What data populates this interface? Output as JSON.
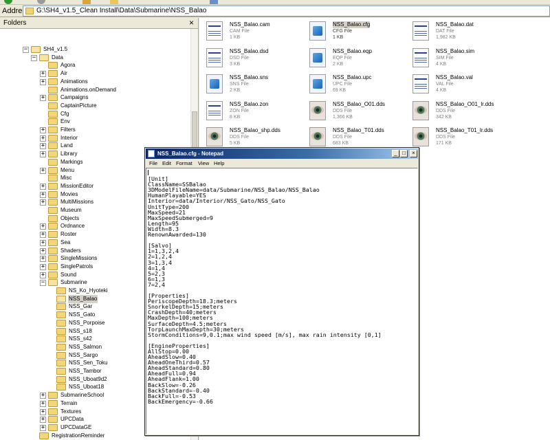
{
  "address": {
    "label": "Address",
    "path": "G:\\SH4_v1.5_Clean Install\\Data\\Submarine\\NSS_Balao"
  },
  "folders_pane": {
    "title": "Folders",
    "close_glyph": "×",
    "tree": [
      {
        "label": "SH4_v1.5",
        "level": 0,
        "expander": "−",
        "open": true
      },
      {
        "label": "Data",
        "level": 1,
        "expander": "−",
        "open": true
      },
      {
        "label": "Agora",
        "level": 2,
        "expander": ""
      },
      {
        "label": "Air",
        "level": 2,
        "expander": "+"
      },
      {
        "label": "Animations",
        "level": 2,
        "expander": "+"
      },
      {
        "label": "Animations.onDemand",
        "level": 2,
        "expander": ""
      },
      {
        "label": "Campaigns",
        "level": 2,
        "expander": "+"
      },
      {
        "label": "CaptainPicture",
        "level": 2,
        "expander": ""
      },
      {
        "label": "Cfg",
        "level": 2,
        "expander": ""
      },
      {
        "label": "Env",
        "level": 2,
        "expander": ""
      },
      {
        "label": "Filters",
        "level": 2,
        "expander": "+"
      },
      {
        "label": "Interior",
        "level": 2,
        "expander": "+"
      },
      {
        "label": "Land",
        "level": 2,
        "expander": "+"
      },
      {
        "label": "Library",
        "level": 2,
        "expander": "+"
      },
      {
        "label": "Markings",
        "level": 2,
        "expander": ""
      },
      {
        "label": "Menu",
        "level": 2,
        "expander": "+"
      },
      {
        "label": "Misc",
        "level": 2,
        "expander": ""
      },
      {
        "label": "MissionEditor",
        "level": 2,
        "expander": "+"
      },
      {
        "label": "Movies",
        "level": 2,
        "expander": "+"
      },
      {
        "label": "MultiMissions",
        "level": 2,
        "expander": "+"
      },
      {
        "label": "Museum",
        "level": 2,
        "expander": ""
      },
      {
        "label": "Objects",
        "level": 2,
        "expander": ""
      },
      {
        "label": "Ordnance",
        "level": 2,
        "expander": "+"
      },
      {
        "label": "Roster",
        "level": 2,
        "expander": "+"
      },
      {
        "label": "Sea",
        "level": 2,
        "expander": "+"
      },
      {
        "label": "Shaders",
        "level": 2,
        "expander": "+"
      },
      {
        "label": "SingleMissions",
        "level": 2,
        "expander": "+"
      },
      {
        "label": "SinglePatrols",
        "level": 2,
        "expander": "+"
      },
      {
        "label": "Sound",
        "level": 2,
        "expander": "+"
      },
      {
        "label": "Submarine",
        "level": 2,
        "expander": "−",
        "open": true
      },
      {
        "label": "NS_Ko_Hyoteki",
        "level": 3,
        "expander": ""
      },
      {
        "label": "NSS_Balao",
        "level": 3,
        "expander": "",
        "selected": true,
        "open": true
      },
      {
        "label": "NSS_Gar",
        "level": 3,
        "expander": ""
      },
      {
        "label": "NSS_Gato",
        "level": 3,
        "expander": ""
      },
      {
        "label": "NSS_Porpoise",
        "level": 3,
        "expander": ""
      },
      {
        "label": "NSS_s18",
        "level": 3,
        "expander": ""
      },
      {
        "label": "NSS_s42",
        "level": 3,
        "expander": ""
      },
      {
        "label": "NSS_Salmon",
        "level": 3,
        "expander": ""
      },
      {
        "label": "NSS_Sargo",
        "level": 3,
        "expander": ""
      },
      {
        "label": "NSS_Sen_Toku",
        "level": 3,
        "expander": ""
      },
      {
        "label": "NSS_Tambor",
        "level": 3,
        "expander": ""
      },
      {
        "label": "NSS_Uboat9d2",
        "level": 3,
        "expander": ""
      },
      {
        "label": "NSS_Uboat18",
        "level": 3,
        "expander": ""
      },
      {
        "label": "SubmarineSchool",
        "level": 2,
        "expander": "+"
      },
      {
        "label": "Terrain",
        "level": 2,
        "expander": "+"
      },
      {
        "label": "Textures",
        "level": 2,
        "expander": "+"
      },
      {
        "label": "UPCData",
        "level": 2,
        "expander": "+"
      },
      {
        "label": "UPCDataGE",
        "level": 2,
        "expander": "+"
      },
      {
        "label": "RegistrationReminder",
        "level": 1,
        "expander": ""
      }
    ]
  },
  "files": [
    {
      "name": "NSS_Balao.cam",
      "type": "CAM File",
      "size": "1 KB",
      "icon": "data-file-icon"
    },
    {
      "name": "NSS_Balao.cfg",
      "type": "CFG File",
      "size": "1 KB",
      "icon": "config-file-icon",
      "highlighted": true
    },
    {
      "name": "NSS_Balao.dat",
      "type": "DAT File",
      "size": "1,982 KB",
      "icon": "data-file-icon"
    },
    {
      "name": "NSS_Balao.dsd",
      "type": "DSD File",
      "size": "3 KB",
      "icon": "data-file-icon"
    },
    {
      "name": "NSS_Balao.eqp",
      "type": "EQP File",
      "size": "2 KB",
      "icon": "config-file-icon"
    },
    {
      "name": "NSS_Balao.sim",
      "type": "SIM File",
      "size": "4 KB",
      "icon": "data-file-icon"
    },
    {
      "name": "NSS_Balao.sns",
      "type": "SNS File",
      "size": "2 KB",
      "icon": "config-file-icon"
    },
    {
      "name": "NSS_Balao.upc",
      "type": "UPC File",
      "size": "69 KB",
      "icon": "config-file-icon"
    },
    {
      "name": "NSS_Balao.val",
      "type": "VAL File",
      "size": "4 KB",
      "icon": "data-file-icon"
    },
    {
      "name": "NSS_Balao.zon",
      "type": "ZON File",
      "size": "8 KB",
      "icon": "data-file-icon"
    },
    {
      "name": "NSS_Balao_O01.dds",
      "type": "DDS File",
      "size": "1,366 KB",
      "icon": "image-file-icon"
    },
    {
      "name": "NSS_Balao_O01_lr.dds",
      "type": "DDS File",
      "size": "342 KB",
      "icon": "image-file-icon"
    },
    {
      "name": "NSS_Balao_shp.dds",
      "type": "DDS File",
      "size": "5 KB",
      "icon": "image-file-icon"
    },
    {
      "name": "NSS_Balao_T01.dds",
      "type": "DDS File",
      "size": "683 KB",
      "icon": "image-file-icon"
    },
    {
      "name": "NSS_Balao_T01_lr.dds",
      "type": "DDS File",
      "size": "171 KB",
      "icon": "image-file-icon"
    }
  ],
  "notepad": {
    "title": "NSS_Balao.cfg - Notepad",
    "buttons": {
      "minimize": "_",
      "maximize": "□",
      "close": "×"
    },
    "menu": [
      "File",
      "Edit",
      "Format",
      "View",
      "Help"
    ],
    "content": "\n[Unit]\nClassName=SSBalao\n3DModelFileName=data/Submarine/NSS_Balao/NSS_Balao\nHumanPlayable=YES\nInterior=data/Interior/NSS_Gato/NSS_Gato\nUnitType=200\nMaxSpeed=21\nMaxSpeedSubmerged=9\nLength=95\nWidth=8.3\nRenownAwarded=130\n\n[Salvo]\n1=1,3,2,4\n2=1,2,4\n3=1,3,4\n4=1,4\n5=2,3\n6=1,3\n7=2,4\n\n[Properties]\nPeriscopeDepth=18.3;meters\nSnorkelDepth=15;meters\nCrashDepth=40;meters\nMaxDepth=100;meters\nSurfaceDepth=4.5;meters\nTorpLaunchMaxDepth=30;meters\nStormConditions=9,0.1;max wind speed [m/s], max rain intensity [0,1]\n\n[EngineProperties]\nAllStop=0.00\nAheadSlow=0.40\nAheadOneThird=0.57\nAheadStandard=0.80\nAheadFull=0.94\nAheadFlank=1.00\nBackSlow=-0.26\nBackStandard=-0.40\nBackFull=-0.53\nBackEmergency=-0.66"
  }
}
